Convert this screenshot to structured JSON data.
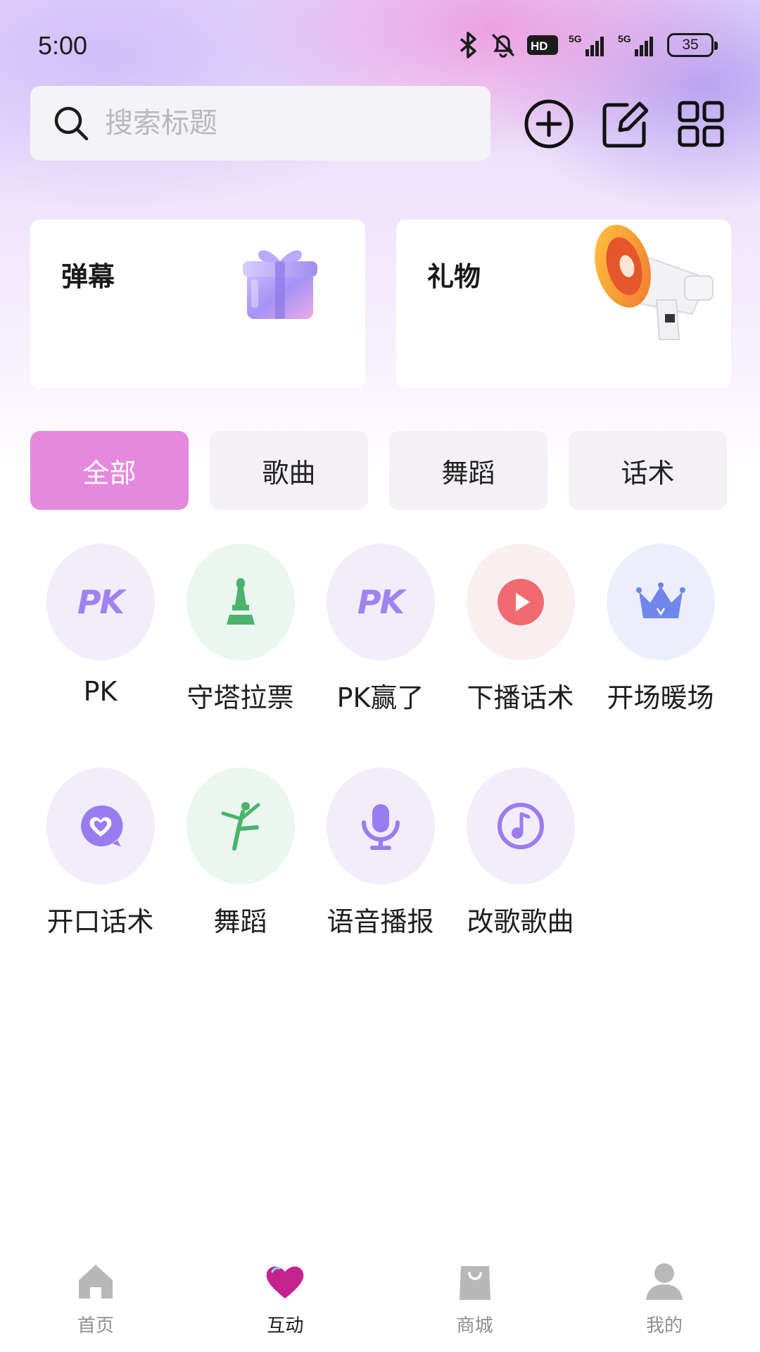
{
  "status_bar": {
    "time": "5:00",
    "battery": "35",
    "icons": [
      "bluetooth-icon",
      "silent-bell-icon",
      "hd-icon",
      "5g-signal-icon",
      "5g-signal-icon",
      "battery-icon"
    ]
  },
  "search": {
    "placeholder": "搜索标题",
    "value": ""
  },
  "top_actions": [
    "add-circle-icon",
    "edit-icon",
    "grid-icon"
  ],
  "cards": [
    {
      "title": "弹幕",
      "art": "gift-box-icon"
    },
    {
      "title": "礼物",
      "art": "megaphone-icon"
    }
  ],
  "tabs": [
    {
      "label": "全部",
      "active": true
    },
    {
      "label": "歌曲",
      "active": false
    },
    {
      "label": "舞蹈",
      "active": false
    },
    {
      "label": "话术",
      "active": false
    }
  ],
  "grid_items": [
    {
      "label": "PK",
      "icon": "pk-icon",
      "icon_text": "PK"
    },
    {
      "label": "守塔拉票",
      "icon": "chess-tower-icon"
    },
    {
      "label": "PK赢了",
      "icon": "pk-icon",
      "icon_text": "PK"
    },
    {
      "label": "下播话术",
      "icon": "play-icon"
    },
    {
      "label": "开场暖场",
      "icon": "crown-icon"
    },
    {
      "label": "开口话术",
      "icon": "heart-chat-icon"
    },
    {
      "label": "舞蹈",
      "icon": "dancer-icon"
    },
    {
      "label": "语音播报",
      "icon": "microphone-icon"
    },
    {
      "label": "改歌歌曲",
      "icon": "music-note-icon"
    }
  ],
  "bottom_nav": [
    {
      "label": "首页",
      "icon": "home-icon",
      "active": false
    },
    {
      "label": "互动",
      "icon": "heart-icon",
      "active": true
    },
    {
      "label": "商城",
      "icon": "shopping-bag-icon",
      "active": false
    },
    {
      "label": "我的",
      "icon": "user-icon",
      "active": false
    }
  ],
  "colors": {
    "accent": "#e589de",
    "active_nav": "#c4238f",
    "inactive_nav": "#b8b8b8",
    "pk_purple": "#a083ef",
    "green": "#4cb36c",
    "red": "#f06a6f",
    "blue": "#6f87ea"
  }
}
